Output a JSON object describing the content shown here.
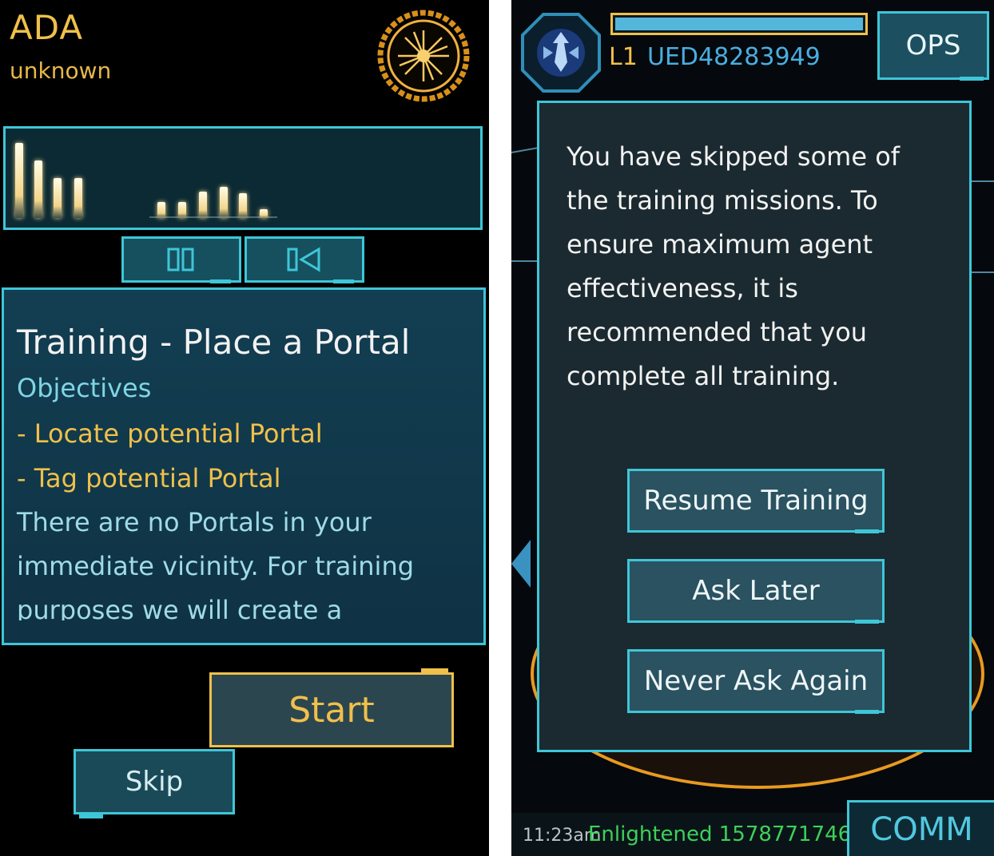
{
  "left_screen": {
    "agent": {
      "name": "ADA",
      "subtitle": "unknown",
      "avatar_icon": "ada-avatar-icon"
    },
    "audio": {
      "levels": [
        0.85,
        0.65,
        0.45,
        0.45,
        0.18,
        0.18,
        0.3,
        0.35,
        0.28,
        0.1
      ]
    },
    "controls": {
      "pause_icon": "pause-icon",
      "rewind_icon": "rewind-icon"
    },
    "mission": {
      "title": "Training - Place a Portal",
      "objectives_label": "Objectives",
      "objectives": [
        "- Locate potential Portal",
        "- Tag potential Portal"
      ],
      "description_lines": [
        "There are no Portals in your",
        "immediate vicinity. For training",
        "purposes we will create a"
      ]
    },
    "buttons": {
      "start": "Start",
      "skip": "Skip"
    }
  },
  "right_screen": {
    "header": {
      "level": "L1",
      "agent_code": "UED48283949",
      "ops": "OPS",
      "xp_progress": 1.0
    },
    "dialog": {
      "message_lines": [
        "You have skipped some of",
        "the training missions. To",
        "ensure maximum agent",
        "effectiveness, it is",
        "recommended that you",
        "complete all training."
      ],
      "buttons": [
        "Resume Training",
        "Ask Later",
        "Never Ask Again"
      ]
    },
    "comm": {
      "time": "11:23am",
      "message": "Enlightened 1578771746 -",
      "label": "COMM"
    }
  },
  "colors": {
    "accent_cyan": "#3ec6d8",
    "accent_gold": "#f0c04a",
    "enlightened_green": "#3ed05a",
    "agent_blue": "#49aee0"
  }
}
